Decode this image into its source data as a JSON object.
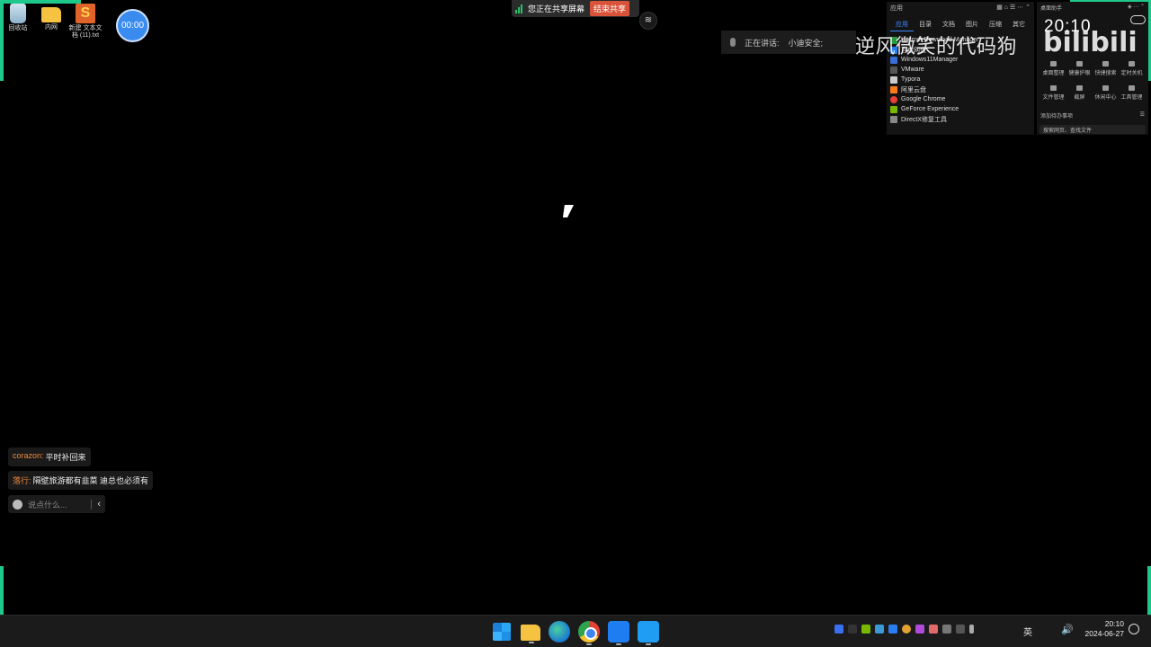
{
  "desktop": {
    "icons": [
      {
        "label": "回收站"
      },
      {
        "label": "内网"
      },
      {
        "label": "新建 文本文档 (11).txt"
      }
    ],
    "timer": "00:00"
  },
  "share_bar": {
    "status": "您正在共享屏幕",
    "end_label": "结束共享"
  },
  "speaking": {
    "label": "正在讲话:",
    "speaker": "小迪安全;"
  },
  "launcher": {
    "title": "应用",
    "tabs": [
      "应用",
      "目录",
      "文档",
      "图片",
      "压缩",
      "其它"
    ],
    "items": [
      "Internet Download Manager",
      "百度网盘",
      "Windows11Manager",
      "VMware",
      "Typora",
      "阿里云盘",
      "Google Chrome",
      "GeForce Experience",
      "DirectX修复工具"
    ]
  },
  "assistant": {
    "title": "桌面助手",
    "clock": "20:10",
    "tools": [
      "桌面整理",
      "健康护眼",
      "快捷搜索",
      "定时关机",
      "文件管理",
      "截屏",
      "休闲中心",
      "工具管理"
    ],
    "todo_label": "添加待办事项",
    "search_placeholder": "搜索网页、查找文件"
  },
  "watermark": {
    "channel": "逆风微笑的代码狗",
    "logo": "bilibili"
  },
  "chat": {
    "messages": [
      {
        "user": "corazon:",
        "text": "平时补回来"
      },
      {
        "user": "落行:",
        "text": "隔壁旅游都有韭菜  迪总也必须有"
      }
    ],
    "input_placeholder": "说点什么..."
  },
  "taskbar": {
    "apps": [
      "start-icon",
      "file-explorer-icon",
      "edge-icon",
      "chrome-icon",
      "tencent-meeting-icon",
      "whiteboard-icon"
    ],
    "language": "英",
    "time": "20:10",
    "date": "2024-06-27"
  },
  "colors": {
    "share_border": "#1ec88a",
    "end_share_button": "#d9533a",
    "chat_username": "#f08a3c",
    "launcher_active_tab": "#3d8bff"
  }
}
